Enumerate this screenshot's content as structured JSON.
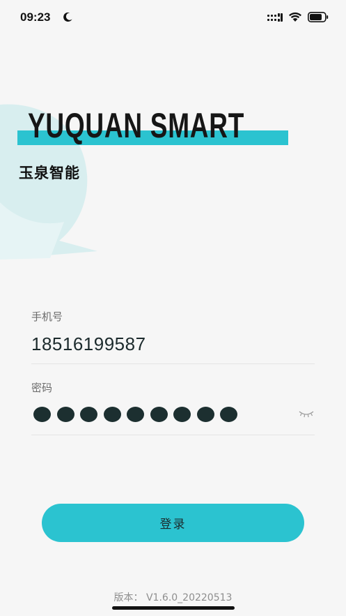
{
  "status_bar": {
    "time": "09:23",
    "icons": [
      "moon-icon",
      "signal-icon",
      "wifi-icon",
      "battery-icon"
    ]
  },
  "brand": {
    "name": "YUQUAN SMART",
    "name_cn": "玉泉智能",
    "accent_color": "#2bc3d0"
  },
  "form": {
    "phone_label": "手机号",
    "phone_value": "18516199587",
    "password_label": "密码",
    "password_length": 9,
    "toggle_icon": "eye-closed-icon"
  },
  "login_button": {
    "label": "登录",
    "color": "#2bc3d0"
  },
  "footer": {
    "version": "版本： V1.6.0_20220513"
  }
}
